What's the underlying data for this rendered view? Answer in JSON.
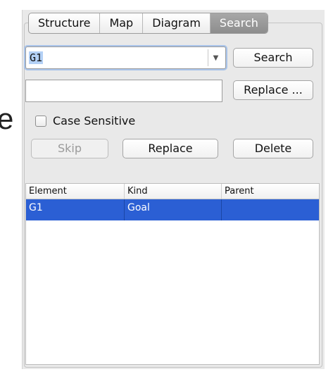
{
  "background_glyph": "e",
  "tabs": [
    {
      "label": "Structure",
      "active": false
    },
    {
      "label": "Map",
      "active": false
    },
    {
      "label": "Diagram",
      "active": false
    },
    {
      "label": "Search",
      "active": true
    }
  ],
  "search": {
    "query_value": "G1",
    "search_label": "Search",
    "replace_value": "",
    "replace_dialog_label": "Replace ...",
    "case_sensitive_label": "Case Sensitive",
    "case_sensitive_checked": false,
    "skip_label": "Skip",
    "replace_label": "Replace",
    "delete_label": "Delete"
  },
  "results": {
    "columns": [
      "Element",
      "Kind",
      "Parent"
    ],
    "rows": [
      {
        "element": "G1",
        "kind": "Goal",
        "parent": "",
        "selected": true
      }
    ]
  },
  "colors": {
    "selection": "#2b5fd4",
    "active_tab": "#9a9a9a",
    "focus_ring": "#a9c4ea"
  }
}
